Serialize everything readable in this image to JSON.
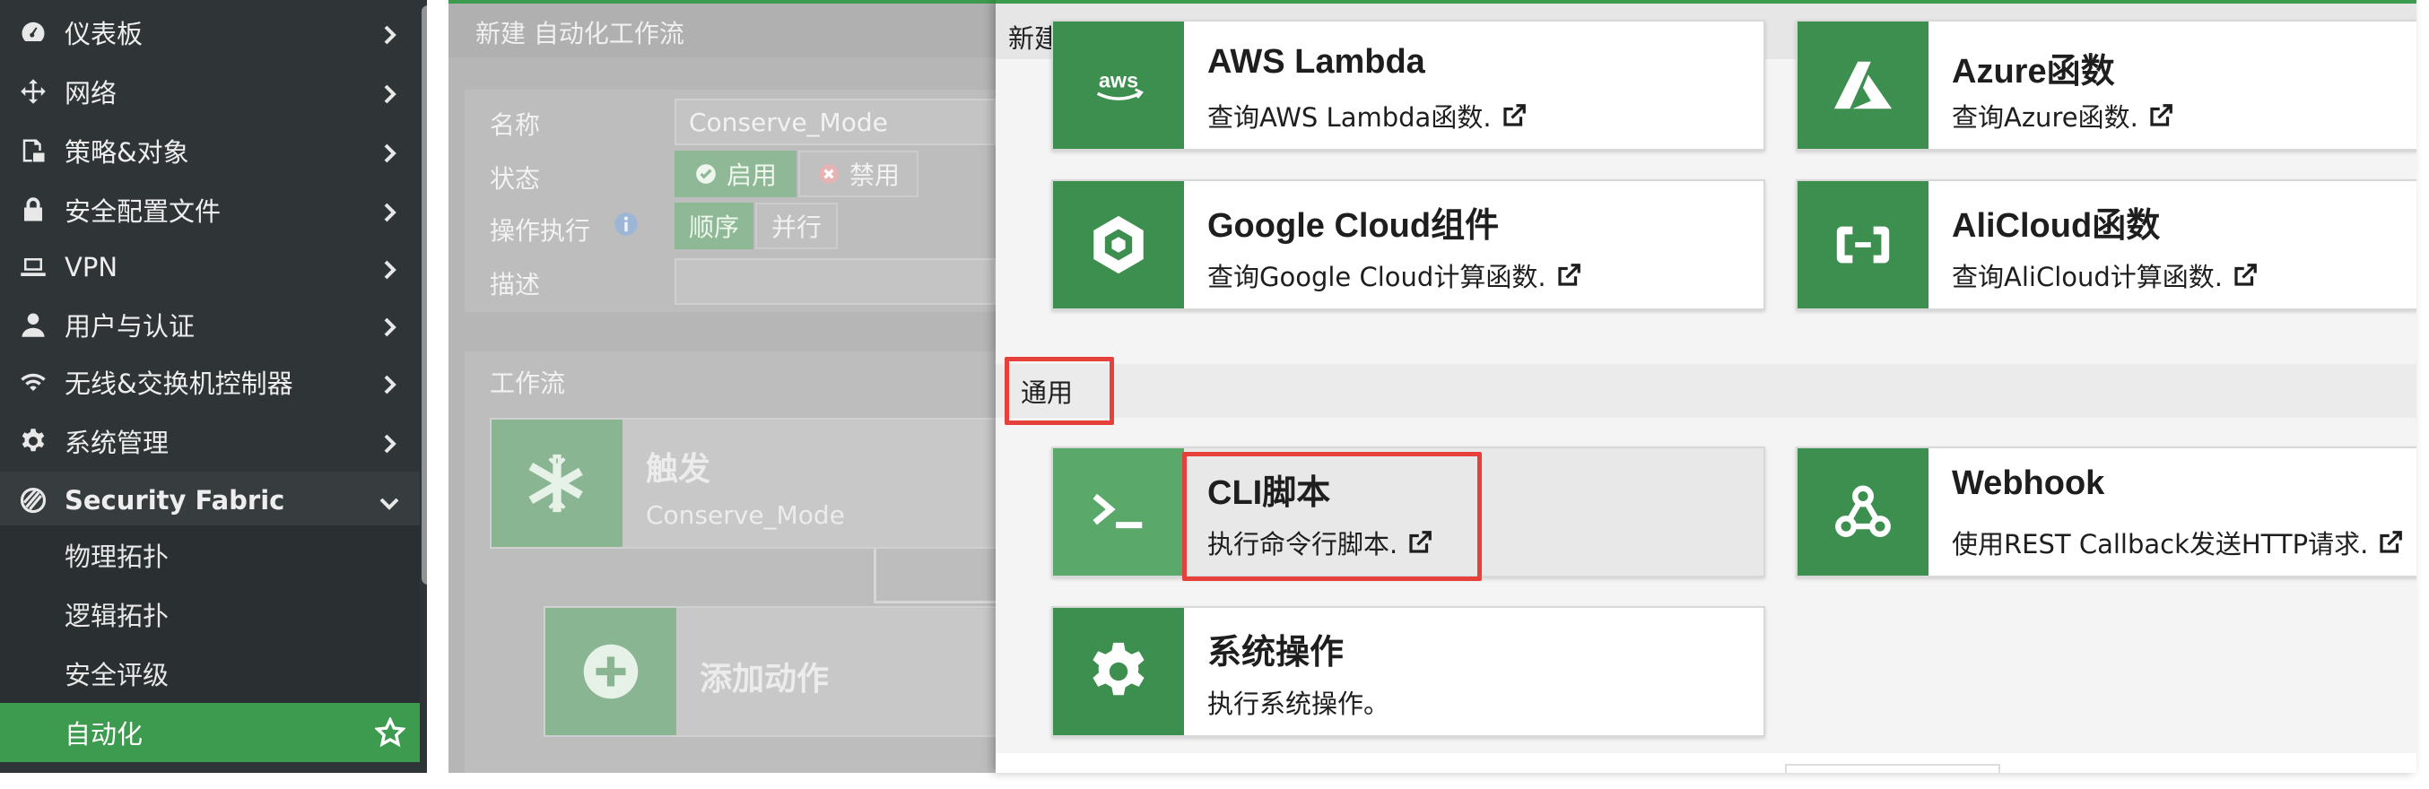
{
  "sidebar": {
    "items": [
      {
        "label": "仪表板",
        "icon": "dashboard-icon"
      },
      {
        "label": "网络",
        "icon": "network-arrows-icon"
      },
      {
        "label": "策略&对象",
        "icon": "policy-icon"
      },
      {
        "label": "安全配置文件",
        "icon": "lock-icon"
      },
      {
        "label": "VPN",
        "icon": "laptop-icon"
      },
      {
        "label": "用户与认证",
        "icon": "user-icon"
      },
      {
        "label": "无线&交换机控制器",
        "icon": "wifi-icon"
      },
      {
        "label": "系统管理",
        "icon": "gear-icon"
      },
      {
        "label": "Security Fabric",
        "icon": "fabric-icon"
      }
    ],
    "fabric_sub": [
      {
        "label": "物理拓扑"
      },
      {
        "label": "逻辑拓扑"
      },
      {
        "label": "安全评级"
      },
      {
        "label": "自动化",
        "active": true
      }
    ]
  },
  "background_page": {
    "title": "新建 自动化工作流",
    "form": {
      "name_label": "名称",
      "name_value": "Conserve_Mode",
      "status_label": "状态",
      "status_enable": "启用",
      "status_disable": "禁用",
      "exec_label": "操作执行",
      "exec_sequential": "顺序",
      "exec_parallel": "并行",
      "desc_label": "描述"
    },
    "workflow": {
      "label": "工作流",
      "trigger_title": "触发",
      "trigger_value": "Conserve_Mode",
      "add_action": "添加动作"
    }
  },
  "modal": {
    "title": "新建 自动化动作",
    "cards_top": [
      {
        "name": "AWS Lambda",
        "desc": "查询AWS Lambda函数.",
        "icon": "aws-icon"
      },
      {
        "name": "Azure函数",
        "desc": "查询Azure函数.",
        "icon": "azure-icon"
      },
      {
        "name": "Google Cloud组件",
        "desc": "查询Google Cloud计算函数.",
        "icon": "google-cloud-icon"
      },
      {
        "name": "AliCloud函数",
        "desc": "查询AliCloud计算函数.",
        "icon": "alicloud-icon"
      }
    ],
    "section_general": "通用",
    "cards_general": [
      {
        "name": "CLI脚本",
        "desc": "执行命令行脚本.",
        "icon": "terminal-icon"
      },
      {
        "name": "Webhook",
        "desc": "使用REST Callback发送HTTP请求.",
        "icon": "webhook-icon"
      },
      {
        "name": "系统操作",
        "desc": "执行系统操作。",
        "icon": "gear-icon"
      }
    ]
  },
  "colors": {
    "accent_green": "#3d9b4f",
    "card_icon_green": "#3d8f50",
    "highlight_red": "#e5413a",
    "sidebar_bg": "#2f3436"
  }
}
